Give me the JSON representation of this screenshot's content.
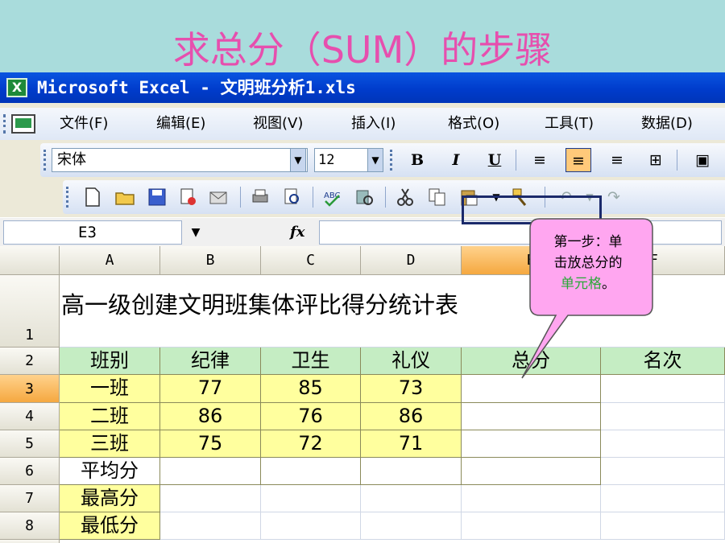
{
  "slide": {
    "title": "求总分（SUM）的步骤"
  },
  "window": {
    "app_label": "X",
    "title": "Microsoft Excel - 文明班分析1.xls"
  },
  "menu": [
    "文件(F)",
    "编辑(E)",
    "视图(V)",
    "插入(I)",
    "格式(O)",
    "工具(T)",
    "数据(D)"
  ],
  "format_toolbar": {
    "font": "宋体",
    "size": "12",
    "bold": "B",
    "italic": "I",
    "underline": "U"
  },
  "formula_bar": {
    "name_box": "E3",
    "fx": "fx",
    "formula": ""
  },
  "grid": {
    "columns": [
      "A",
      "B",
      "C",
      "D",
      "E",
      "F"
    ],
    "rows": [
      "1",
      "2",
      "3",
      "4",
      "5",
      "6",
      "7",
      "8"
    ],
    "selected_cell": "E3",
    "title": "高一级创建文明班集体评比得分统计表",
    "headers": [
      "班别",
      "纪律",
      "卫生",
      "礼仪",
      "总分",
      "名次"
    ],
    "data_rows": [
      [
        "一班",
        "77",
        "85",
        "73",
        "",
        ""
      ],
      [
        "二班",
        "86",
        "76",
        "86",
        "",
        ""
      ],
      [
        "三班",
        "75",
        "72",
        "71",
        "",
        ""
      ]
    ],
    "stat_labels": [
      "平均分",
      "最高分",
      "最低分"
    ]
  },
  "callout": {
    "line1": "第一步：单",
    "line2": "击放总分的",
    "highlight": "单元格",
    "suffix": "。",
    "colors": {
      "fill": "#ffa6f0",
      "highlight": "#2aa838"
    }
  }
}
